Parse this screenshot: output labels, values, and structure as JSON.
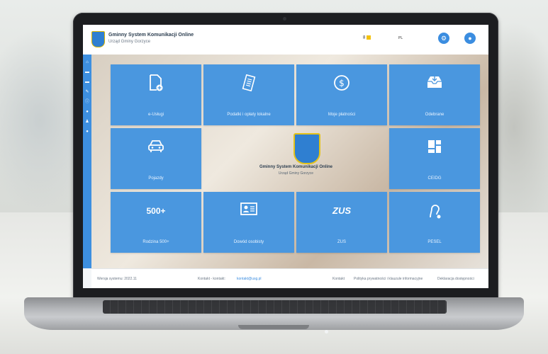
{
  "header": {
    "app_title": "Gminny System Komunikacji Online",
    "app_subtitle": "Urząd Gminy Gorzyce",
    "badge_count": "8",
    "language": "PL",
    "settings_icon": "gear-icon",
    "user_icon": "user-icon"
  },
  "sidebar": {
    "icons": [
      "home-icon",
      "car-icon",
      "car-icon",
      "pencil-icon",
      "info-icon",
      "circle-icon",
      "user-icon",
      "circle-icon"
    ]
  },
  "tiles": [
    {
      "label": "e-Usługi",
      "icon": "document-add-icon"
    },
    {
      "label": "Podatki i opłaty lokalne",
      "icon": "receipt-icon"
    },
    {
      "label": "Moje płatności",
      "icon": "dollar-icon"
    },
    {
      "label": "Odebrane",
      "icon": "inbox-icon"
    },
    {
      "label": "Pojazdy",
      "icon": "car-icon"
    },
    {
      "label": "CEIDG",
      "icon": "blocks-icon"
    },
    {
      "label": "Rodzina 500+",
      "icon": "500-plus-icon",
      "icon_text": "500+"
    },
    {
      "label": "Dowód osobisty",
      "icon": "id-card-icon"
    },
    {
      "label": "ZUS",
      "icon": "zus-icon",
      "icon_text": "ZUS"
    },
    {
      "label": "PESEL",
      "icon": "person-icon"
    }
  ],
  "center": {
    "title": "Gminny System Komunikacji Online",
    "subtitle": "Urząd Gminy Gorzyce"
  },
  "footer": {
    "version": "Wersja systemu: 2022.11",
    "contact_label": "Kontakt - kontakt:",
    "contact_link": "kontakt@usg.pl",
    "links": [
      "Kontakt",
      "Polityka prywatności i klauzule informacyjne",
      "Deklaracja dostępności"
    ]
  },
  "colors": {
    "tile": "#4a97df",
    "sidebar": "#3d8fe0",
    "accent_yellow": "#f4c20d"
  }
}
